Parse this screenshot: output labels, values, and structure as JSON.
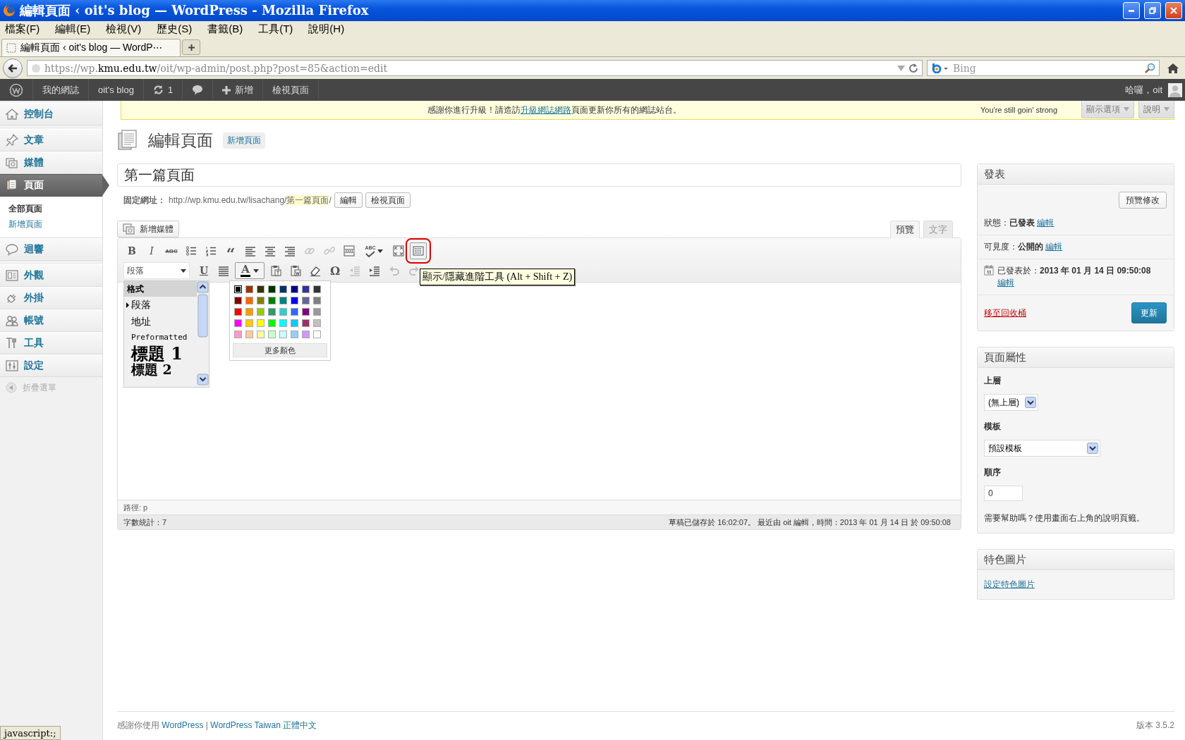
{
  "browser": {
    "title": "編輯頁面 ‹ oit's blog — WordPress - Mozilla Firefox",
    "menu": [
      "檔案(F)",
      "編輯(E)",
      "檢視(V)",
      "歷史(S)",
      "書籤(B)",
      "工具(T)",
      "說明(H)"
    ],
    "tabs": [
      {
        "label": "編輯頁面 ‹ oit's blog — WordP⋯",
        "selected": true
      }
    ],
    "url": {
      "prefix": "https://wp.",
      "domain": "kmu.edu.tw",
      "path": "/oit/wp-admin/post.php?post=85&action=edit"
    },
    "search": {
      "placeholder": "Bing"
    }
  },
  "admin_bar": {
    "items": [
      {
        "kind": "logo"
      },
      {
        "kind": "text",
        "label": "我的網誌"
      },
      {
        "kind": "text",
        "label": "oit's blog"
      },
      {
        "kind": "updates",
        "label": "1"
      },
      {
        "kind": "comments"
      },
      {
        "kind": "new",
        "label": "新增"
      },
      {
        "kind": "text",
        "label": "檢視頁面"
      }
    ],
    "greeting": "哈囉，oit"
  },
  "sidebar": {
    "items": [
      {
        "kind": "dashboard",
        "label": "控制台",
        "selected": false
      },
      {
        "kind": "posts",
        "label": "文章",
        "selected": false
      },
      {
        "kind": "media",
        "label": "媒體",
        "selected": false
      },
      {
        "kind": "pages",
        "label": "頁面",
        "selected": true,
        "children": [
          {
            "label": "全部頁面",
            "selected": true
          },
          {
            "label": "新增頁面",
            "selected": false
          }
        ]
      },
      {
        "kind": "comments",
        "label": "迴響",
        "selected": false
      },
      {
        "kind": "appearance",
        "label": "外觀",
        "selected": false
      },
      {
        "kind": "plugins",
        "label": "外掛",
        "selected": false
      },
      {
        "kind": "users",
        "label": "帳號",
        "selected": false
      },
      {
        "kind": "tools",
        "label": "工具",
        "selected": false
      },
      {
        "kind": "settings",
        "label": "設定",
        "selected": false
      }
    ],
    "collapse": "折疊選單"
  },
  "notice": {
    "before": "感謝你進行升級！請造訪",
    "link": "升級網誌網路",
    "after": "頁面更新你所有的網誌站台。",
    "aside": "You're still goin' strong"
  },
  "screen_tabs": [
    "顯示選項",
    "說明"
  ],
  "heading": {
    "title": "編輯頁面",
    "add_new": "新增頁面"
  },
  "post": {
    "title": "第一篇頁面",
    "permalink": {
      "label": "固定網址：",
      "base": "http://wp.kmu.edu.tw/lisachang/",
      "slug": "第一篇頁面",
      "trail": "/",
      "buttons": [
        "編輯",
        "檢視頁面"
      ]
    },
    "add_media": "新增媒體",
    "editor_tabs": [
      {
        "label": "預覽",
        "selected": true
      },
      {
        "label": "文字",
        "selected": false
      }
    ],
    "toolbar_rows": [
      [
        {
          "kind": "bold",
          "label": "B",
          "disabled": false,
          "active": false,
          "circled": false
        },
        {
          "kind": "italic",
          "label": "I",
          "disabled": false,
          "active": false,
          "circled": false
        },
        {
          "kind": "strike",
          "label": "ABC",
          "disabled": false,
          "active": false,
          "circled": false
        },
        {
          "kind": "bullist",
          "disabled": false,
          "active": false,
          "circled": false
        },
        {
          "kind": "numlist",
          "disabled": false,
          "active": false,
          "circled": false
        },
        {
          "kind": "quote",
          "label": "“",
          "disabled": false,
          "active": false,
          "circled": false
        },
        {
          "kind": "alignleft",
          "disabled": false,
          "active": false,
          "circled": false
        },
        {
          "kind": "aligncenter",
          "disabled": false,
          "active": false,
          "circled": false
        },
        {
          "kind": "alignright",
          "disabled": false,
          "active": false,
          "circled": false
        },
        {
          "kind": "link",
          "disabled": true,
          "active": false,
          "circled": false
        },
        {
          "kind": "unlink",
          "disabled": true,
          "active": false,
          "circled": false
        },
        {
          "kind": "more",
          "disabled": false,
          "active": false,
          "circled": false
        },
        {
          "kind": "spellcheck",
          "label": "ABC",
          "disabled": false,
          "active": false,
          "circled": false
        },
        {
          "kind": "fullscreen",
          "disabled": false,
          "active": false,
          "circled": false
        },
        {
          "kind": "kitchensink",
          "disabled": false,
          "active": true,
          "circled": true
        }
      ],
      [
        {
          "kind": "formatselect",
          "label": "段落",
          "disabled": false,
          "active": false,
          "circled": false
        },
        {
          "kind": "underline",
          "label": "U",
          "disabled": false,
          "active": false,
          "circled": false
        },
        {
          "kind": "justify",
          "disabled": false,
          "active": false,
          "circled": false
        },
        {
          "kind": "forecolor",
          "label": "A",
          "disabled": false,
          "active": true,
          "circled": false
        },
        {
          "kind": "pastetext",
          "disabled": false,
          "active": false,
          "circled": false
        },
        {
          "kind": "pasteword",
          "disabled": false,
          "active": false,
          "circled": false
        },
        {
          "kind": "removeformat",
          "disabled": false,
          "active": false,
          "circled": false
        },
        {
          "kind": "charmap",
          "label": "Ω",
          "disabled": false,
          "active": false,
          "circled": false
        },
        {
          "kind": "outdent",
          "disabled": true,
          "active": false,
          "circled": false
        },
        {
          "kind": "indent",
          "disabled": false,
          "active": false,
          "circled": false
        },
        {
          "kind": "undo",
          "disabled": true,
          "active": false,
          "circled": false
        },
        {
          "kind": "redo",
          "disabled": true,
          "active": false,
          "circled": false
        }
      ]
    ],
    "format_menu": {
      "title": "格式",
      "items": [
        {
          "kind": "p",
          "label": "段落",
          "selected": true
        },
        {
          "kind": "address",
          "label": "地址",
          "selected": false
        },
        {
          "kind": "pre",
          "label": "Preformatted",
          "selected": false
        },
        {
          "kind": "h1",
          "label": "標題 1",
          "selected": false
        },
        {
          "kind": "h2",
          "label": "標題 2",
          "selected": false
        }
      ]
    },
    "color_picker": {
      "colors": [
        {
          "color": "#000000",
          "selected": true
        },
        {
          "color": "#993300",
          "selected": false
        },
        {
          "color": "#333300",
          "selected": false
        },
        {
          "color": "#003300",
          "selected": false
        },
        {
          "color": "#003366",
          "selected": false
        },
        {
          "color": "#000080",
          "selected": false
        },
        {
          "color": "#333399",
          "selected": false
        },
        {
          "color": "#333333",
          "selected": false
        },
        {
          "color": "#800000",
          "selected": false
        },
        {
          "color": "#ff6600",
          "selected": false
        },
        {
          "color": "#808000",
          "selected": false
        },
        {
          "color": "#008000",
          "selected": false
        },
        {
          "color": "#008080",
          "selected": false
        },
        {
          "color": "#0000ff",
          "selected": false
        },
        {
          "color": "#666699",
          "selected": false
        },
        {
          "color": "#808080",
          "selected": false
        },
        {
          "color": "#ff0000",
          "selected": false
        },
        {
          "color": "#ff9900",
          "selected": false
        },
        {
          "color": "#99cc00",
          "selected": false
        },
        {
          "color": "#339966",
          "selected": false
        },
        {
          "color": "#33cccc",
          "selected": false
        },
        {
          "color": "#3366ff",
          "selected": false
        },
        {
          "color": "#800080",
          "selected": false
        },
        {
          "color": "#999999",
          "selected": false
        },
        {
          "color": "#ff00ff",
          "selected": false
        },
        {
          "color": "#ffcc00",
          "selected": false
        },
        {
          "color": "#ffff00",
          "selected": false
        },
        {
          "color": "#00ff00",
          "selected": false
        },
        {
          "color": "#00ffff",
          "selected": false
        },
        {
          "color": "#00ccff",
          "selected": false
        },
        {
          "color": "#993366",
          "selected": false
        },
        {
          "color": "#c0c0c0",
          "selected": false
        },
        {
          "color": "#ff99cc",
          "selected": false
        },
        {
          "color": "#ffcc99",
          "selected": false
        },
        {
          "color": "#ffff99",
          "selected": false
        },
        {
          "color": "#ccffcc",
          "selected": false
        },
        {
          "color": "#ccffff",
          "selected": false
        },
        {
          "color": "#99ccff",
          "selected": false
        },
        {
          "color": "#cc99ff",
          "selected": false
        },
        {
          "color": "#ffffff",
          "selected": false
        }
      ],
      "more": "更多顏色"
    },
    "tooltip": "顯示/隱藏進階工具 (Alt + Shift + Z)",
    "path": "路徑: p",
    "word_count": "字數統計：7",
    "last_edit": "草稿已儲存於 16:02:07。 最近由 oit 編輯，時間：2013 年 01 月 14 日 於 09:50:08"
  },
  "publish": {
    "title": "發表",
    "preview": "預覽修改",
    "rows": [
      {
        "kind": "status",
        "text": "狀態：**已發表**",
        "link": "編輯"
      },
      {
        "kind": "visibility",
        "text": "可見度：**公開的**",
        "link": "編輯"
      },
      {
        "kind": "date",
        "text": "已發表於：**2013 年 01 月 14 日 09:50:08**",
        "link": "編輯"
      }
    ],
    "trash": "移至回收桶",
    "update": "更新"
  },
  "page_attributes": {
    "title": "頁面屬性",
    "parent": {
      "label": "上層",
      "value": "(無上層)"
    },
    "template": {
      "label": "模板",
      "value": "預設模板"
    },
    "order": {
      "label": "順序",
      "value": "0"
    },
    "help": "需要幫助嗎？使用畫面右上角的說明頁籤。"
  },
  "featured_image": {
    "title": "特色圖片",
    "link": "設定特色圖片"
  },
  "footer": {
    "before": "感謝你使用 ",
    "links": [
      "WordPress",
      "WordPress Taiwan 正體中文"
    ],
    "separator": " | ",
    "version": "版本 3.5.2"
  },
  "status_bar": "javascript:;"
}
